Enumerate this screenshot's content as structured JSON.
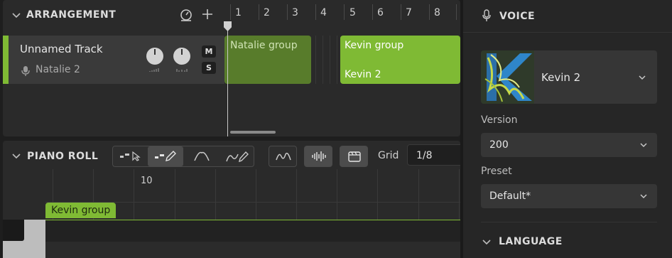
{
  "arrangement": {
    "title": "ARRANGEMENT",
    "ruler": [
      "1",
      "2",
      "3",
      "4",
      "5",
      "6",
      "7",
      "8"
    ],
    "track": {
      "name": "Unnamed Track",
      "singer": "Natalie 2",
      "mute_label": "M",
      "solo_label": "S",
      "color": "#7fba34"
    },
    "clips": [
      {
        "label": "Natalie group",
        "sublabel": "",
        "color": "#587c2b"
      },
      {
        "label": "Kevin group",
        "sublabel": "Kevin 2",
        "color": "#7fba34"
      }
    ]
  },
  "pianoroll": {
    "title": "PIANO ROLL",
    "grid_label": "Grid",
    "grid_value": "1/8",
    "ruler_number": "10",
    "clip_label": "Kevin group"
  },
  "voice": {
    "title": "VOICE",
    "singer_name": "Kevin 2",
    "version_label": "Version",
    "version_value": "200",
    "preset_label": "Preset",
    "preset_value": "Default*",
    "language_title": "LANGUAGE"
  },
  "icons": {
    "arrangement_collapse": "chevron-down-icon",
    "metronome": "metronome-icon",
    "add_track": "plus-icon",
    "mic": "microphone-icon",
    "select_tool": "select-tool-icon",
    "pencil_tool": "pencil-tool-icon",
    "vibrato_tool": "vibrato-tool-icon",
    "curve_tool": "curve-pen-tool-icon",
    "pitch_view": "pitch-curve-icon",
    "waveform_view": "waveform-icon",
    "clapperboard": "clapperboard-icon"
  },
  "colors": {
    "accent_green": "#7fba34",
    "dark_green": "#587c2b"
  }
}
